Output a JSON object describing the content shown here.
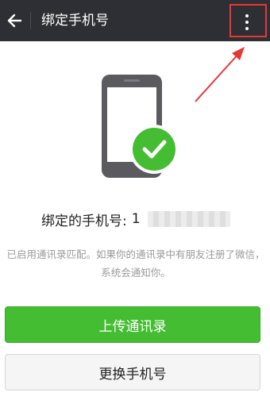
{
  "header": {
    "title": "绑定手机号",
    "back_icon": "arrow-left-icon",
    "more_icon": "more-vertical-icon"
  },
  "annotation": {
    "box_color": "#e53935",
    "arrow_color": "#e53935"
  },
  "illustration": {
    "phone_icon": "smartphone-icon",
    "check_icon": "check-circle-icon",
    "check_color": "#44bd32"
  },
  "bound": {
    "label": "绑定的手机号:",
    "number_visible": "1"
  },
  "hint": "已启用通讯录匹配。如果你的通讯录中有朋友注册了微信，系统会通知你。",
  "buttons": {
    "upload_label": "上传通讯录",
    "change_label": "更换手机号"
  },
  "colors": {
    "topbar": "#2e2f34",
    "primary": "#44bd32"
  }
}
